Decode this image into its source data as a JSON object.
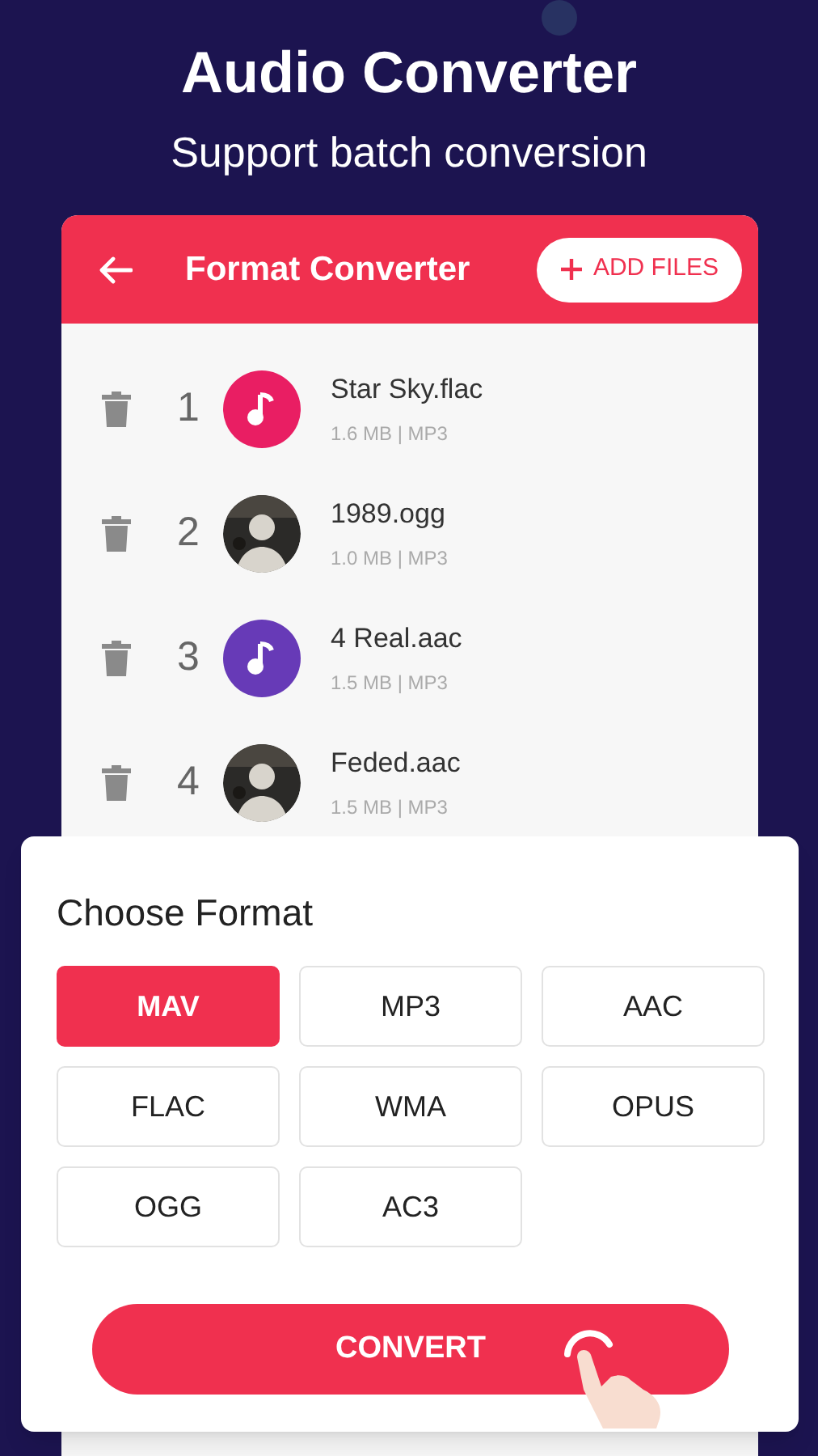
{
  "headline": "Audio Converter",
  "subtitle": "Support batch conversion",
  "app_bar": {
    "title": "Format Converter",
    "action": "ADD FILES"
  },
  "files": [
    {
      "number": "1",
      "name": "Star Sky.flac",
      "details": "1.6 MB | MP3",
      "kind": "icon",
      "color": "#e91e63"
    },
    {
      "number": "2",
      "name": "1989.ogg",
      "details": "1.0 MB | MP3",
      "kind": "picture"
    },
    {
      "number": "3",
      "name": "4 Real.aac",
      "details": "1.5 MB | MP3",
      "kind": "icon",
      "color": "#673ab7"
    },
    {
      "number": "4",
      "name": "Feded.aac",
      "details": "1.5 MB | MP3",
      "kind": "picture"
    }
  ],
  "format_sheet": {
    "title": "Choose Format",
    "formats": [
      {
        "label": "MAV",
        "selected": true
      },
      {
        "label": "MP3",
        "selected": false
      },
      {
        "label": "AAC",
        "selected": false
      },
      {
        "label": "FLAC",
        "selected": false
      },
      {
        "label": "WMA",
        "selected": false
      },
      {
        "label": "OPUS",
        "selected": false
      },
      {
        "label": "OGG",
        "selected": false
      },
      {
        "label": "AC3",
        "selected": false
      }
    ],
    "button": "CONVERT"
  }
}
